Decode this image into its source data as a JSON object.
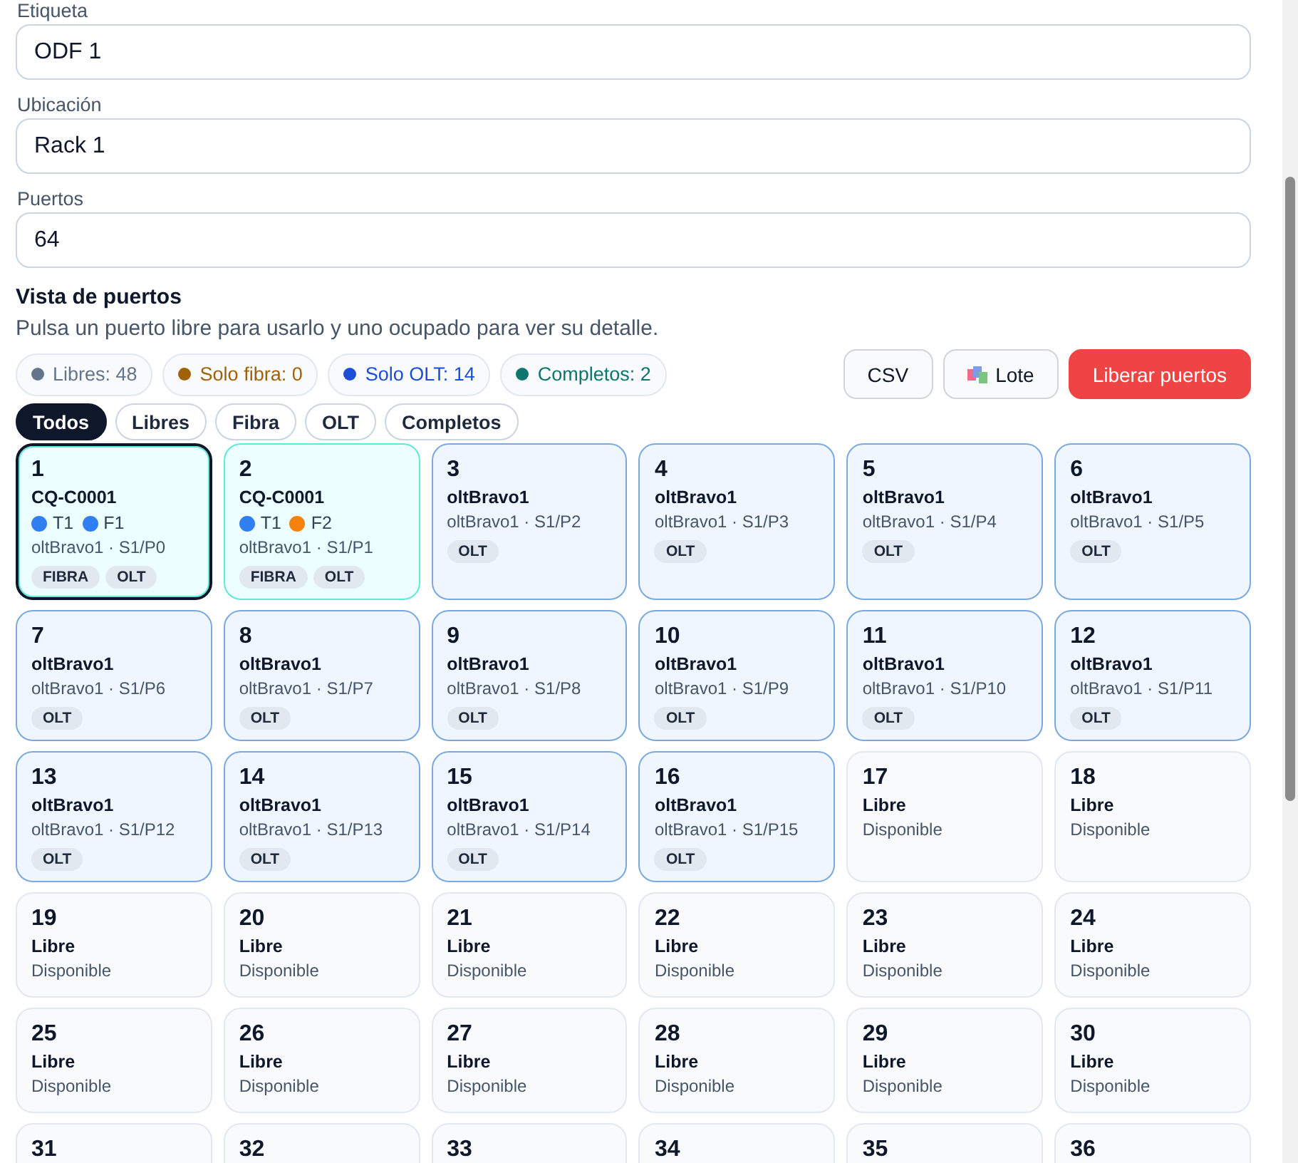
{
  "fields": [
    {
      "label": "Etiqueta",
      "value": "ODF 1"
    },
    {
      "label": "Ubicación",
      "value": "Rack 1"
    },
    {
      "label": "Puertos",
      "value": "64"
    }
  ],
  "section": {
    "title": "Vista de puertos",
    "description": "Pulsa un puerto libre para usarlo y uno ocupado para ver su detalle."
  },
  "summary": [
    {
      "label": "Libres: 48",
      "color": "#64748b"
    },
    {
      "label": "Solo fibra: 0",
      "color": "#a16207"
    },
    {
      "label": "Solo OLT: 14",
      "color": "#1d4ed8"
    },
    {
      "label": "Completos: 2",
      "color": "#0f766e"
    }
  ],
  "actions": [
    {
      "label": "CSV",
      "kind": "plain"
    },
    {
      "label": "Lote",
      "kind": "icon"
    },
    {
      "label": "Liberar puertos",
      "kind": "danger"
    }
  ],
  "filters": [
    {
      "label": "Todos",
      "selected": true
    },
    {
      "label": "Libres",
      "selected": false
    },
    {
      "label": "Fibra",
      "selected": false
    },
    {
      "label": "OLT",
      "selected": false
    },
    {
      "label": "Completos",
      "selected": false
    }
  ],
  "ports": [
    {
      "number": "1",
      "kind": "complete",
      "selected": true,
      "title": "CQ-C0001",
      "dots": [
        {
          "label": "T1",
          "color": "#2f7ff0"
        },
        {
          "label": "F1",
          "color": "#2f7ff0"
        }
      ],
      "detail": "oltBravo1 · S1/P0",
      "tags": [
        "FIBRA",
        "OLT"
      ]
    },
    {
      "number": "2",
      "kind": "complete",
      "selected": false,
      "title": "CQ-C0001",
      "dots": [
        {
          "label": "T1",
          "color": "#2f7ff0"
        },
        {
          "label": "F2",
          "color": "#f5820d"
        }
      ],
      "detail": "oltBravo1 · S1/P1",
      "tags": [
        "FIBRA",
        "OLT"
      ]
    },
    {
      "number": "3",
      "kind": "olt",
      "selected": false,
      "title": "oltBravo1",
      "detail": "oltBravo1 · S1/P2",
      "tags": [
        "OLT"
      ]
    },
    {
      "number": "4",
      "kind": "olt",
      "selected": false,
      "title": "oltBravo1",
      "detail": "oltBravo1 · S1/P3",
      "tags": [
        "OLT"
      ]
    },
    {
      "number": "5",
      "kind": "olt",
      "selected": false,
      "title": "oltBravo1",
      "detail": "oltBravo1 · S1/P4",
      "tags": [
        "OLT"
      ]
    },
    {
      "number": "6",
      "kind": "olt",
      "selected": false,
      "title": "oltBravo1",
      "detail": "oltBravo1 · S1/P5",
      "tags": [
        "OLT"
      ]
    },
    {
      "number": "7",
      "kind": "olt",
      "selected": false,
      "title": "oltBravo1",
      "detail": "oltBravo1 · S1/P6",
      "tags": [
        "OLT"
      ]
    },
    {
      "number": "8",
      "kind": "olt",
      "selected": false,
      "title": "oltBravo1",
      "detail": "oltBravo1 · S1/P7",
      "tags": [
        "OLT"
      ]
    },
    {
      "number": "9",
      "kind": "olt",
      "selected": false,
      "title": "oltBravo1",
      "detail": "oltBravo1 · S1/P8",
      "tags": [
        "OLT"
      ]
    },
    {
      "number": "10",
      "kind": "olt",
      "selected": false,
      "title": "oltBravo1",
      "detail": "oltBravo1 · S1/P9",
      "tags": [
        "OLT"
      ]
    },
    {
      "number": "11",
      "kind": "olt",
      "selected": false,
      "title": "oltBravo1",
      "detail": "oltBravo1 · S1/P10",
      "tags": [
        "OLT"
      ]
    },
    {
      "number": "12",
      "kind": "olt",
      "selected": false,
      "title": "oltBravo1",
      "detail": "oltBravo1 · S1/P11",
      "tags": [
        "OLT"
      ]
    },
    {
      "number": "13",
      "kind": "olt",
      "selected": false,
      "title": "oltBravo1",
      "detail": "oltBravo1 · S1/P12",
      "tags": [
        "OLT"
      ]
    },
    {
      "number": "14",
      "kind": "olt",
      "selected": false,
      "title": "oltBravo1",
      "detail": "oltBravo1 · S1/P13",
      "tags": [
        "OLT"
      ]
    },
    {
      "number": "15",
      "kind": "olt",
      "selected": false,
      "title": "oltBravo1",
      "detail": "oltBravo1 · S1/P14",
      "tags": [
        "OLT"
      ]
    },
    {
      "number": "16",
      "kind": "olt",
      "selected": false,
      "title": "oltBravo1",
      "detail": "oltBravo1 · S1/P15",
      "tags": [
        "OLT"
      ]
    },
    {
      "number": "17",
      "kind": "free",
      "selected": false,
      "title": "Libre",
      "detail": "Disponible"
    },
    {
      "number": "18",
      "kind": "free",
      "selected": false,
      "title": "Libre",
      "detail": "Disponible"
    },
    {
      "number": "19",
      "kind": "free",
      "selected": false,
      "title": "Libre",
      "detail": "Disponible"
    },
    {
      "number": "20",
      "kind": "free",
      "selected": false,
      "title": "Libre",
      "detail": "Disponible"
    },
    {
      "number": "21",
      "kind": "free",
      "selected": false,
      "title": "Libre",
      "detail": "Disponible"
    },
    {
      "number": "22",
      "kind": "free",
      "selected": false,
      "title": "Libre",
      "detail": "Disponible"
    },
    {
      "number": "23",
      "kind": "free",
      "selected": false,
      "title": "Libre",
      "detail": "Disponible"
    },
    {
      "number": "24",
      "kind": "free",
      "selected": false,
      "title": "Libre",
      "detail": "Disponible"
    },
    {
      "number": "25",
      "kind": "free",
      "selected": false,
      "title": "Libre",
      "detail": "Disponible"
    },
    {
      "number": "26",
      "kind": "free",
      "selected": false,
      "title": "Libre",
      "detail": "Disponible"
    },
    {
      "number": "27",
      "kind": "free",
      "selected": false,
      "title": "Libre",
      "detail": "Disponible"
    },
    {
      "number": "28",
      "kind": "free",
      "selected": false,
      "title": "Libre",
      "detail": "Disponible"
    },
    {
      "number": "29",
      "kind": "free",
      "selected": false,
      "title": "Libre",
      "detail": "Disponible"
    },
    {
      "number": "30",
      "kind": "free",
      "selected": false,
      "title": "Libre",
      "detail": "Disponible"
    },
    {
      "number": "31",
      "kind": "free",
      "selected": false
    },
    {
      "number": "32",
      "kind": "free",
      "selected": false
    },
    {
      "number": "33",
      "kind": "free",
      "selected": false
    },
    {
      "number": "34",
      "kind": "free",
      "selected": false
    },
    {
      "number": "35",
      "kind": "free",
      "selected": false
    },
    {
      "number": "36",
      "kind": "free",
      "selected": false
    }
  ]
}
